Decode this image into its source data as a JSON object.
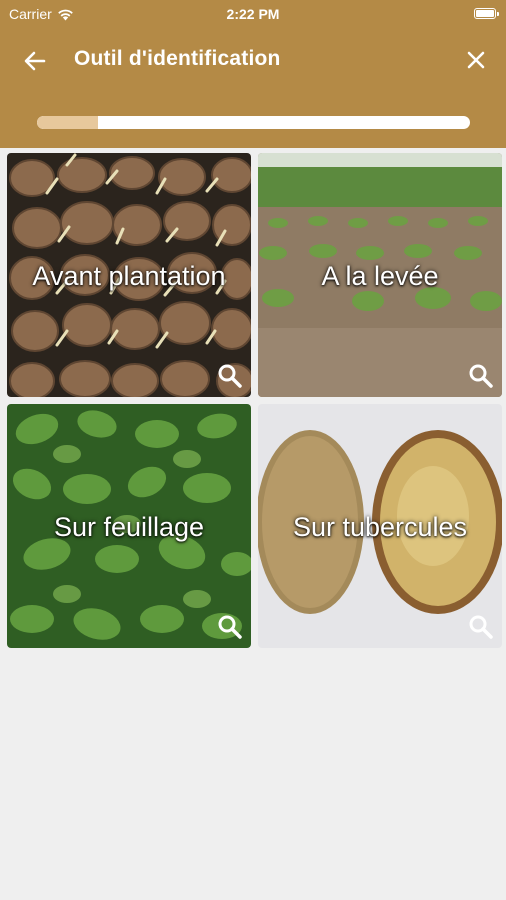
{
  "status_bar": {
    "carrier": "Carrier",
    "time": "2:22 PM"
  },
  "nav": {
    "title": "Outil d'identification"
  },
  "progress": {
    "fraction": 0.14
  },
  "tiles": [
    {
      "label": "Avant plantation",
      "icon": "magnifier-icon"
    },
    {
      "label": "A la levée",
      "icon": "magnifier-icon"
    },
    {
      "label": "Sur feuillage",
      "icon": "magnifier-icon"
    },
    {
      "label": "Sur tubercules",
      "icon": "magnifier-icon"
    }
  ],
  "colors": {
    "header": "#b48a46",
    "progress_fill": "#e7c89c",
    "background": "#efefef"
  }
}
